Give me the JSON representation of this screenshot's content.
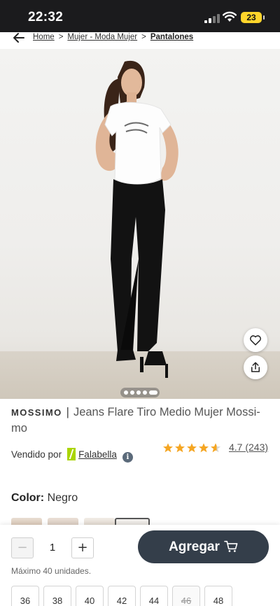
{
  "status_bar": {
    "time": "22:32",
    "battery": "23"
  },
  "breadcrumb": {
    "items": [
      {
        "label": "Home"
      },
      {
        "label": "Mujer - Moda Mujer"
      },
      {
        "label": "Pantalones"
      }
    ],
    "separator": ">"
  },
  "product": {
    "brand": "MOSSIMO",
    "title_separator": "|",
    "title": "Jeans Flare Tiro Medio Mujer Mossi-mo",
    "image_count": 5,
    "active_image": 1
  },
  "seller": {
    "prefix": "Vendido por",
    "name": "Falabella",
    "info_icon": "i",
    "logo_color": "#aad500"
  },
  "rating": {
    "value": 4.7,
    "text": "4.7 (243)",
    "max": 5,
    "star_color": "#f5a623"
  },
  "color": {
    "label": "Color:",
    "value": "Negro"
  },
  "cart": {
    "minus": "−",
    "quantity": "1",
    "plus": "+",
    "add_label": "Agregar",
    "max_note": "Máximo 40 unidades.",
    "button_color": "#343e4a"
  },
  "sizes": [
    {
      "label": "36",
      "available": true
    },
    {
      "label": "38",
      "available": true
    },
    {
      "label": "40",
      "available": true
    },
    {
      "label": "42",
      "available": true
    },
    {
      "label": "44",
      "available": true
    },
    {
      "label": "46",
      "available": false
    },
    {
      "label": "48",
      "available": true
    }
  ],
  "icons": [
    "back-arrow-icon",
    "signal-icon",
    "wifi-icon",
    "heart-icon",
    "share-icon",
    "cart-icon",
    "info-icon",
    "star-icon"
  ]
}
